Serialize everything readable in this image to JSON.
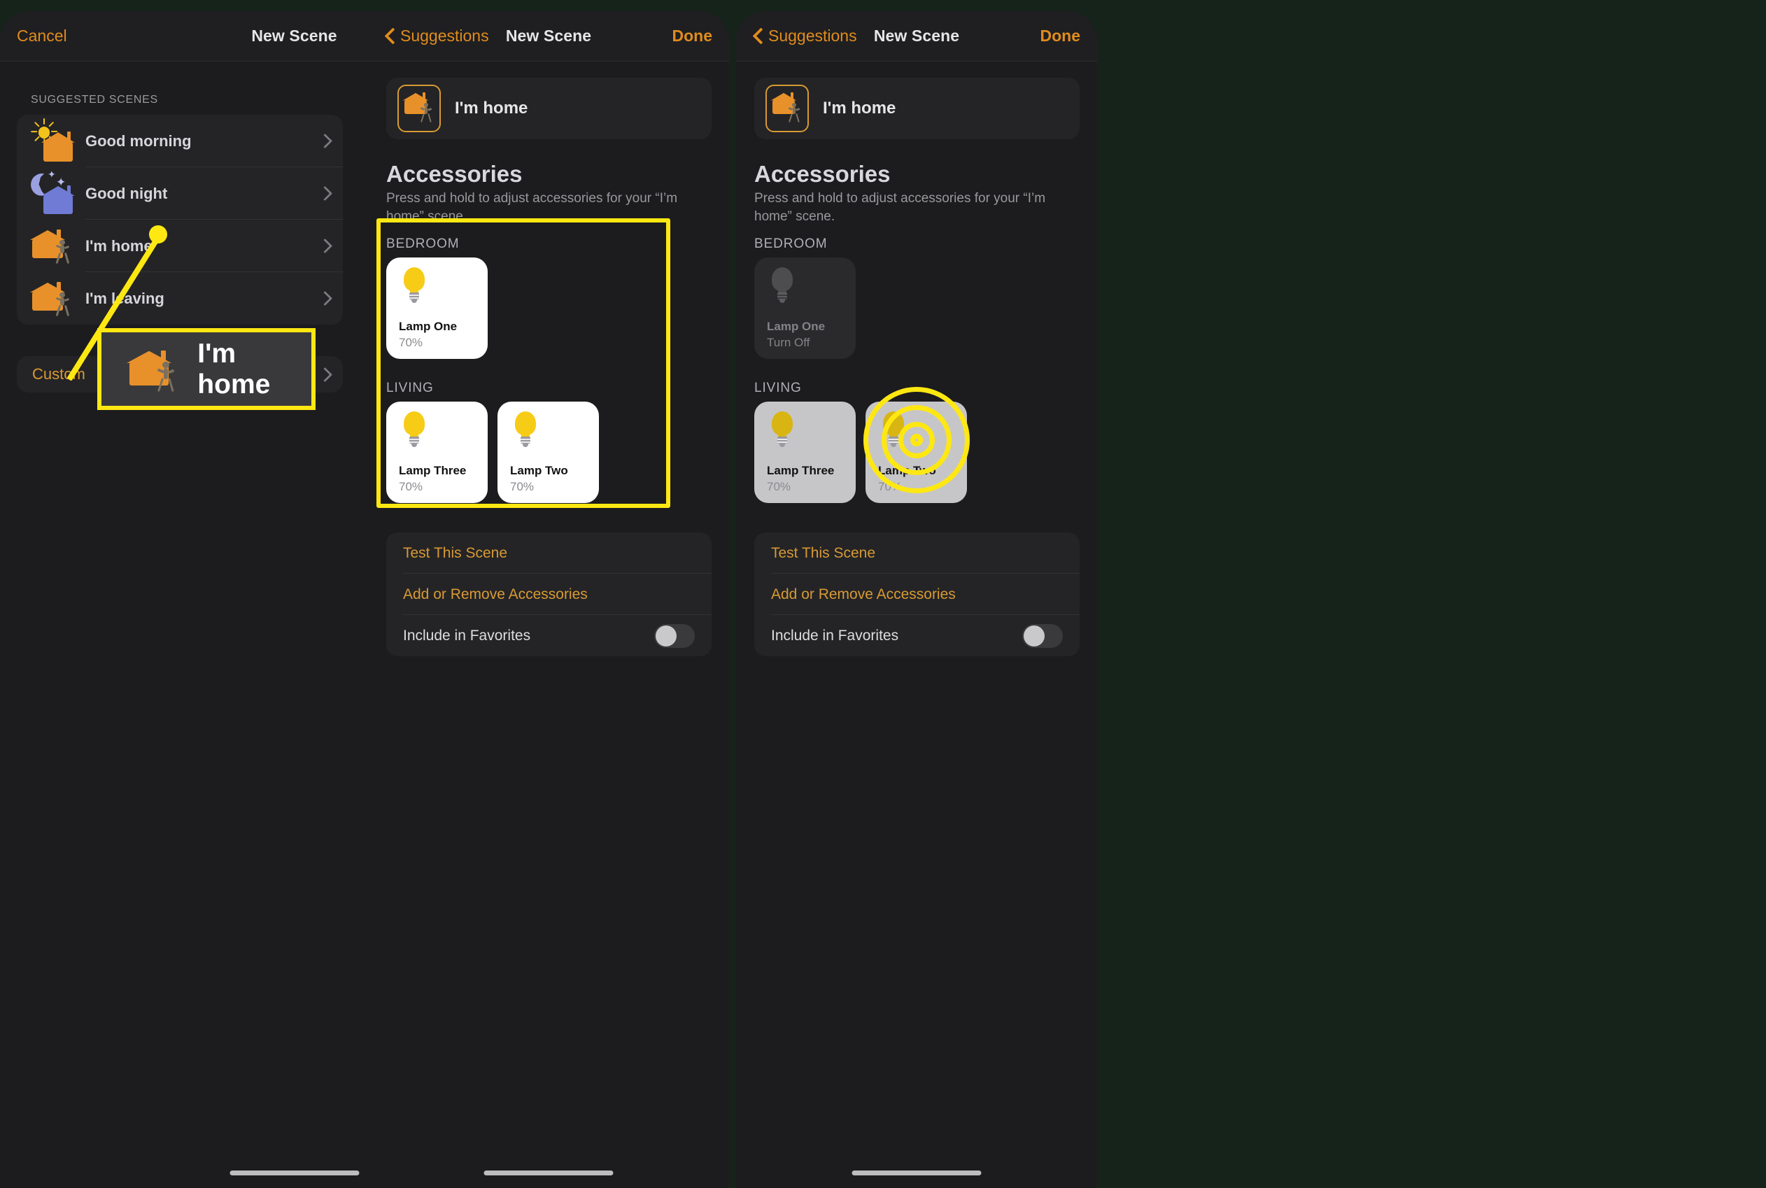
{
  "colors": {
    "accent_orange": "#e08c1e",
    "annotation_yellow": "#ffe812",
    "panel_bg": "#1c1c1e",
    "card_bg": "#242426",
    "bulb_yellow": "#f6cc17",
    "house_orange": "#e8912a",
    "house_blue": "#6f7bd4",
    "backdrop_green": "#16231b"
  },
  "panel_left": {
    "nav": {
      "cancel_label": "Cancel",
      "title": "New Scene"
    },
    "section_label": "SUGGESTED SCENES",
    "scenes": [
      {
        "name": "Good morning",
        "icon": "sun-house-icon"
      },
      {
        "name": "Good night",
        "icon": "moon-house-icon"
      },
      {
        "name": "I'm home",
        "icon": "house-walking-in-icon"
      },
      {
        "name": "I'm leaving",
        "icon": "house-walking-out-icon"
      }
    ],
    "custom_label": "Custom",
    "callout": {
      "label": "I'm home",
      "icon": "house-walking-icon"
    }
  },
  "panel_mid": {
    "nav": {
      "back_label": "Suggestions",
      "title": "New Scene",
      "done_label": "Done"
    },
    "scene_name": "I'm home",
    "accessories": {
      "title": "Accessories",
      "subtitle": "Press and hold to adjust accessories for your “I’m home” scene.",
      "rooms": [
        {
          "label": "BEDROOM",
          "tiles": [
            {
              "name": "Lamp One",
              "status": "70%",
              "state": "on"
            }
          ]
        },
        {
          "label": "LIVING",
          "tiles": [
            {
              "name": "Lamp Three",
              "status": "70%",
              "state": "on"
            },
            {
              "name": "Lamp Two",
              "status": "70%",
              "state": "on"
            }
          ]
        }
      ]
    },
    "actions": [
      {
        "label": "Test This Scene",
        "type": "link"
      },
      {
        "label": "Add or Remove Accessories",
        "type": "link"
      },
      {
        "label": "Include in Favorites",
        "type": "toggle",
        "value": "off"
      }
    ]
  },
  "panel_right": {
    "nav": {
      "back_label": "Suggestions",
      "title": "New Scene",
      "done_label": "Done"
    },
    "scene_name": "I'm home",
    "accessories": {
      "title": "Accessories",
      "subtitle": "Press and hold to adjust accessories for your “I’m home” scene.",
      "rooms": [
        {
          "label": "BEDROOM",
          "tiles": [
            {
              "name": "Lamp One",
              "status": "Turn Off",
              "state": "off"
            }
          ]
        },
        {
          "label": "LIVING",
          "tiles": [
            {
              "name": "Lamp Three",
              "status": "70%",
              "state": "dim"
            },
            {
              "name": "Lamp Two",
              "status": "70%",
              "state": "dim"
            }
          ]
        }
      ]
    },
    "actions": [
      {
        "label": "Test This Scene",
        "type": "link"
      },
      {
        "label": "Add or Remove Accessories",
        "type": "link"
      },
      {
        "label": "Include in Favorites",
        "type": "toggle",
        "value": "off"
      }
    ]
  }
}
